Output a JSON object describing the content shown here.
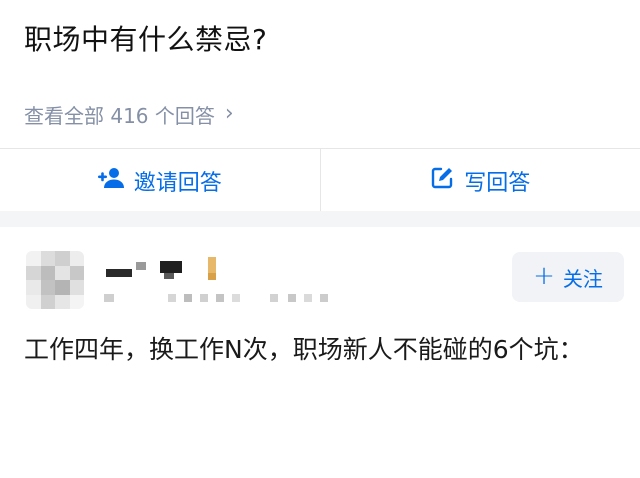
{
  "question": {
    "title": "职场中有什么禁忌?",
    "view_all_label": "查看全部 416 个回答"
  },
  "actions": {
    "invite_label": "邀请回答",
    "write_label": "写回答"
  },
  "author": {
    "follow_label": "关注"
  },
  "answer": {
    "text": "工作四年，换工作N次，职场新人不能碰的6个坑："
  },
  "icons": {
    "invite": "add-user-icon",
    "write": "edit-icon",
    "view_all": "chevron-right-icon",
    "follow": "plus-icon"
  },
  "colors": {
    "accent": "#056de8",
    "muted": "#8590a6",
    "follow_bg": "#f1f3f6"
  }
}
